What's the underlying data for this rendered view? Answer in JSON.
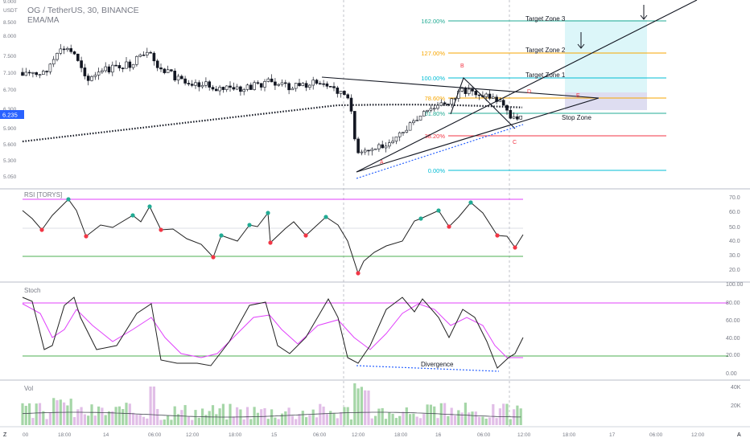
{
  "header": {
    "symbol_title": "OG / TetherUS, 30, BINANCE",
    "indicator": "EMA/MA"
  },
  "price_axis": {
    "currency": "USDT",
    "ticks": [
      "9.000",
      "8.500",
      "8.000",
      "7.500",
      "7.100",
      "6.700",
      "6.300",
      "5.900",
      "5.600",
      "5.300",
      "5.050"
    ],
    "current_price": "6.235",
    "current_price_color": "#2962ff"
  },
  "fib_levels": [
    {
      "label": "162.00%",
      "color": "#22ab94"
    },
    {
      "label": "127.00%",
      "color": "#f7a600"
    },
    {
      "label": "100.00%",
      "color": "#00bcd4"
    },
    {
      "label": "78.60%",
      "color": "#f7a600"
    },
    {
      "label": "61.80%",
      "color": "#22ab94"
    },
    {
      "label": "38.20%",
      "color": "#f23645"
    },
    {
      "label": "0.00%",
      "color": "#00bcd4"
    }
  ],
  "annotations": {
    "target_zone_3": "Target Zone 3",
    "target_zone_2": "Target Zone 2",
    "target_zone_1": "Target Zone 1",
    "stop_zone": "Stop Zone",
    "point_a": "A",
    "point_b": "B",
    "point_c": "C",
    "point_d": "D",
    "point_e": "E",
    "divergence": "Divergence"
  },
  "rsi": {
    "title": "RSI [TORYS]",
    "ticks": [
      "70.0",
      "60.0",
      "50.0",
      "40.0",
      "30.0",
      "20.0"
    ]
  },
  "stoch": {
    "title": "Stoch",
    "ticks": [
      "100.00",
      "80.00",
      "60.00",
      "40.00",
      "20.00",
      "0.00"
    ]
  },
  "volume": {
    "title": "Vol",
    "ticks": [
      "40K",
      "20K"
    ]
  },
  "time_axis": {
    "labels": [
      "00",
      "18:00",
      "14",
      "06:00",
      "12:00",
      "18:00",
      "15",
      "06:00",
      "12:00",
      "18:00",
      "16",
      "06:00",
      "12:00",
      "18:00",
      "17",
      "06:00",
      "12:00"
    ],
    "left_tool": "Z",
    "right_tool": "A"
  },
  "colors": {
    "up": "#26a69a",
    "down": "#ef5350",
    "rsi_line": "#222222",
    "stoch_k": "#222222",
    "stoch_d": "#e040fb",
    "band": "#e040fb",
    "mid": "#4caf50"
  }
}
